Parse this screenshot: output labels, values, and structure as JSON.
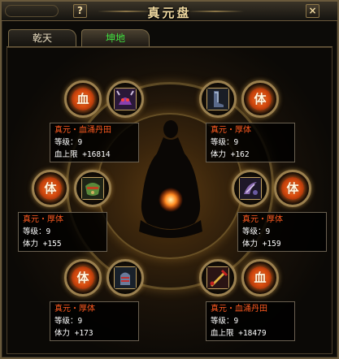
{
  "window": {
    "title": "真元盘",
    "help_label": "?",
    "close_label": "×"
  },
  "tabs": [
    {
      "label": "乾天",
      "color": "#e8dcc0"
    },
    {
      "label": "坤地",
      "color": "#40e040"
    }
  ],
  "slots": [
    {
      "rune": "血",
      "item_icon": "demon-helmet-icon",
      "name": "真元・血涌丹田",
      "level_label": "等级：9",
      "stat_label": "血上限 +16814"
    },
    {
      "rune": "体",
      "item_icon": "boots-icon",
      "name": "真元・厚体",
      "level_label": "等级：9",
      "stat_label": "体力 +162"
    },
    {
      "rune": "体",
      "item_icon": "green-mask-icon",
      "name": "真元・厚体",
      "level_label": "等级：9",
      "stat_label": "体力 +155"
    },
    {
      "rune": "体",
      "item_icon": "purple-claw-icon",
      "name": "真元・厚体",
      "level_label": "等级：9",
      "stat_label": "体力 +159"
    },
    {
      "rune": "体",
      "item_icon": "gauntlet-icon",
      "name": "真元・厚体",
      "level_label": "等级：9",
      "stat_label": "体力 +173"
    },
    {
      "rune": "血",
      "item_icon": "gold-sword-icon",
      "name": "真元・血涌丹田",
      "level_label": "等级：9",
      "stat_label": "血上限 +18479"
    }
  ],
  "colors": {
    "accent_name": "#ff5a20",
    "active_tab_text": "#40e040",
    "border": "#9a8050"
  }
}
